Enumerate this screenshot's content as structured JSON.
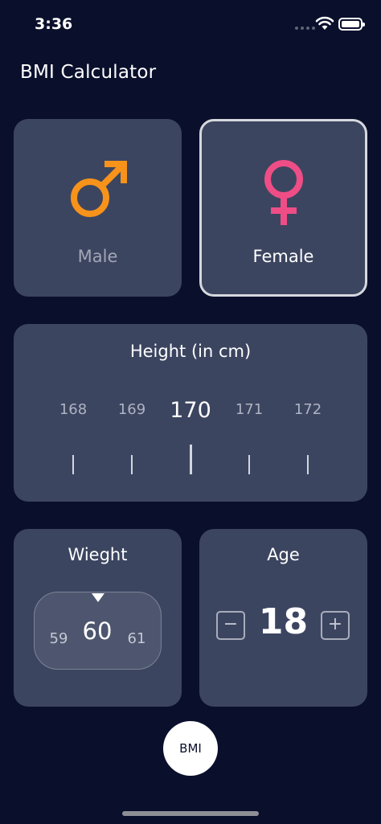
{
  "status_bar": {
    "time": "3:36"
  },
  "app": {
    "title": "BMI Calculator"
  },
  "gender": {
    "male": {
      "label": "Male",
      "icon": "male-symbol-icon",
      "color": "#f7931a",
      "selected": false
    },
    "female": {
      "label": "Female",
      "icon": "female-symbol-icon",
      "color": "#ef4d86",
      "selected": true
    }
  },
  "height": {
    "title": "Height (in cm)",
    "values": [
      "168",
      "169",
      "170",
      "171",
      "172"
    ],
    "selected": "170"
  },
  "weight": {
    "title": "Wieght",
    "values": [
      "59",
      "60",
      "61"
    ],
    "selected": "60"
  },
  "age": {
    "title": "Age",
    "value": "18",
    "minus_label": "−",
    "plus_label": "+"
  },
  "bmi_button": {
    "label": "BMI"
  },
  "colors": {
    "background": "#0a0f2c",
    "card": "#3c4560",
    "accent_male": "#f7931a",
    "accent_female": "#ef4d86"
  }
}
